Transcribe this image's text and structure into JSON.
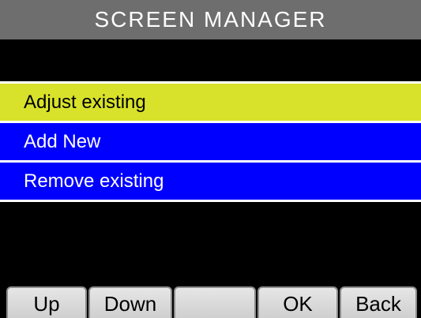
{
  "title": "SCREEN MANAGER",
  "menu": {
    "items": [
      {
        "label": "Adjust existing",
        "selected": true
      },
      {
        "label": "Add New",
        "selected": false
      },
      {
        "label": "Remove existing",
        "selected": false
      }
    ]
  },
  "softkeys": [
    {
      "label": "Up"
    },
    {
      "label": "Down"
    },
    {
      "label": ""
    },
    {
      "label": "OK"
    },
    {
      "label": "Back"
    }
  ],
  "colors": {
    "title_bg": "#6e6e6e",
    "selected_bg": "#d8e22a",
    "item_bg": "#0000ff",
    "screen_bg": "#000000",
    "softkey_bg": "#dcdcdc"
  }
}
